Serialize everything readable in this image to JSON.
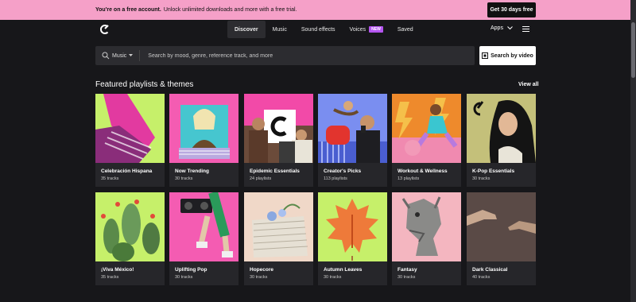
{
  "promo": {
    "bold": "You're on a free account.",
    "text": "Unlock unlimited downloads and more with a free trial.",
    "cta": "Get 30 days free"
  },
  "nav": {
    "tabs": [
      {
        "label": "Discover",
        "active": true
      },
      {
        "label": "Music"
      },
      {
        "label": "Sound effects"
      },
      {
        "label": "Voices",
        "badge": "NEW"
      },
      {
        "label": "Saved"
      }
    ],
    "apps": "Apps"
  },
  "search": {
    "type": "Music",
    "placeholder": "Search by mood, genre, reference track, and more",
    "video_button": "Search by video"
  },
  "section": {
    "title": "Featured playlists & themes",
    "view_all": "View all"
  },
  "cards": [
    {
      "title": "Celebración Hispana",
      "sub": "35 tracks"
    },
    {
      "title": "Now Trending",
      "sub": "30 tracks"
    },
    {
      "title": "Epidemic Essentials",
      "sub": "24 playlists"
    },
    {
      "title": "Creator's Picks",
      "sub": "113 playlists"
    },
    {
      "title": "Workout & Wellness",
      "sub": "13 playlists"
    },
    {
      "title": "K-Pop Essentials",
      "sub": "30 tracks"
    },
    {
      "title": "¡Viva México!",
      "sub": "35 tracks"
    },
    {
      "title": "Uplifting Pop",
      "sub": "30 tracks"
    },
    {
      "title": "Hopecore",
      "sub": "30 tracks"
    },
    {
      "title": "Autumn Leaves",
      "sub": "30 tracks"
    },
    {
      "title": "Fantasy",
      "sub": "30 tracks"
    },
    {
      "title": "Dark Classical",
      "sub": "40 tracks"
    }
  ],
  "colors": {
    "promo_bg": "#f5a0c8",
    "page_bg": "#17171a",
    "badge": "#b455f0"
  }
}
